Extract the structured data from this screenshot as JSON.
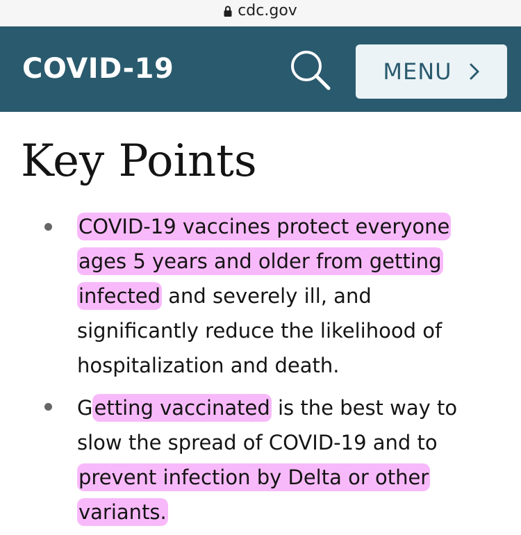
{
  "browser": {
    "url": "cdc.gov",
    "icons": {
      "lock": "lock-icon"
    }
  },
  "header": {
    "title": "COVID-19",
    "menu_label": "MENU",
    "icons": {
      "search": "search-icon",
      "menu_chevron": "chevron-right-icon"
    },
    "colors": {
      "background": "#2a5a6e",
      "menu_button_bg": "#ebf3f6",
      "text": "#ffffff"
    }
  },
  "main": {
    "title": "Key Points",
    "points": [
      {
        "line1": "COVID-19 vaccines protect everyone",
        "line2": "ages 5 years and older from getting",
        "line3_highlight": "infected",
        "line3_rest": " and severely ill, and",
        "line4": "significantly reduce the likelihood of",
        "line5": "hospitalization and death."
      },
      {
        "line1_first": "G",
        "line1_highlight": "etting vaccinated",
        "line1_rest": " is the best way to",
        "line2": "slow the spread of COVID-19 and to",
        "line3": "prevent infection by Delta or other",
        "line4": "variants."
      }
    ],
    "colors": {
      "highlight": "#f280f6",
      "bullet": "#666666"
    }
  }
}
